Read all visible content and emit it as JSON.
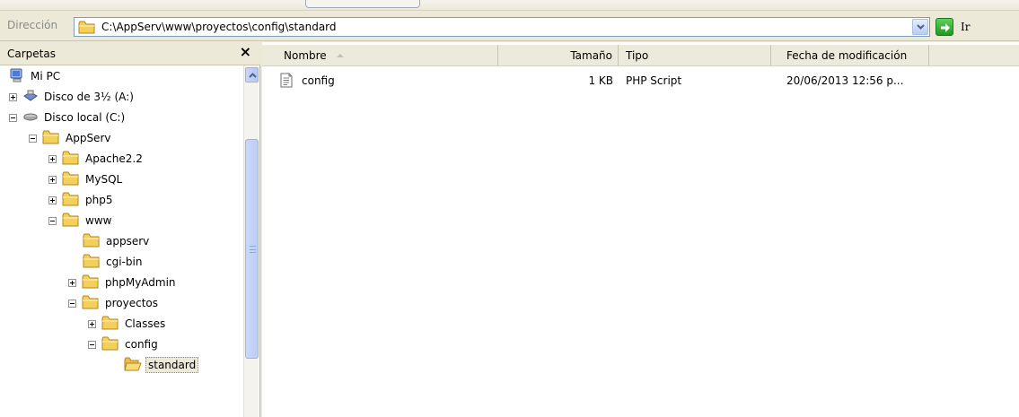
{
  "address": {
    "label": "Dirección",
    "path": "C:\\AppServ\\www\\proyectos\\config\\standard",
    "go_label": "Ir"
  },
  "folders_pane": {
    "title": "Carpetas",
    "close_label": "×"
  },
  "tree": [
    {
      "label": "Mi PC",
      "icon": "computer-icon",
      "state": "none"
    },
    {
      "label": "Disco de 3½ (A:)",
      "icon": "floppy-icon",
      "state": "collapsed"
    },
    {
      "label": "Disco local (C:)",
      "icon": "hard-drive-icon",
      "state": "expanded"
    },
    {
      "label": "AppServ",
      "icon": "folder-icon",
      "state": "expanded"
    },
    {
      "label": "Apache2.2",
      "icon": "folder-icon",
      "state": "collapsed"
    },
    {
      "label": "MySQL",
      "icon": "folder-icon",
      "state": "collapsed"
    },
    {
      "label": "php5",
      "icon": "folder-icon",
      "state": "collapsed"
    },
    {
      "label": "www",
      "icon": "folder-icon",
      "state": "expanded"
    },
    {
      "label": "appserv",
      "icon": "folder-icon",
      "state": "none"
    },
    {
      "label": "cgi-bin",
      "icon": "folder-icon",
      "state": "none"
    },
    {
      "label": "phpMyAdmin",
      "icon": "folder-icon",
      "state": "collapsed"
    },
    {
      "label": "proyectos",
      "icon": "folder-icon",
      "state": "expanded"
    },
    {
      "label": "Classes",
      "icon": "folder-icon",
      "state": "collapsed"
    },
    {
      "label": "config",
      "icon": "folder-icon",
      "state": "expanded"
    },
    {
      "label": "standard",
      "icon": "open-folder-icon",
      "state": "none",
      "selected": true
    }
  ],
  "list": {
    "columns": {
      "name": "Nombre",
      "size": "Tamaño",
      "type": "Tipo",
      "date": "Fecha de modificación"
    },
    "sort_column": "name",
    "sort_direction": "ascending",
    "rows": [
      {
        "name": "config",
        "icon": "php-file-icon",
        "size": "1 KB",
        "type": "PHP Script",
        "date": "20/06/2013 12:56 p..."
      }
    ]
  },
  "colors": {
    "window_bg": "#ece9d8",
    "accent_blue": "#316ac5",
    "folder_yellow": "#f5d56b"
  }
}
